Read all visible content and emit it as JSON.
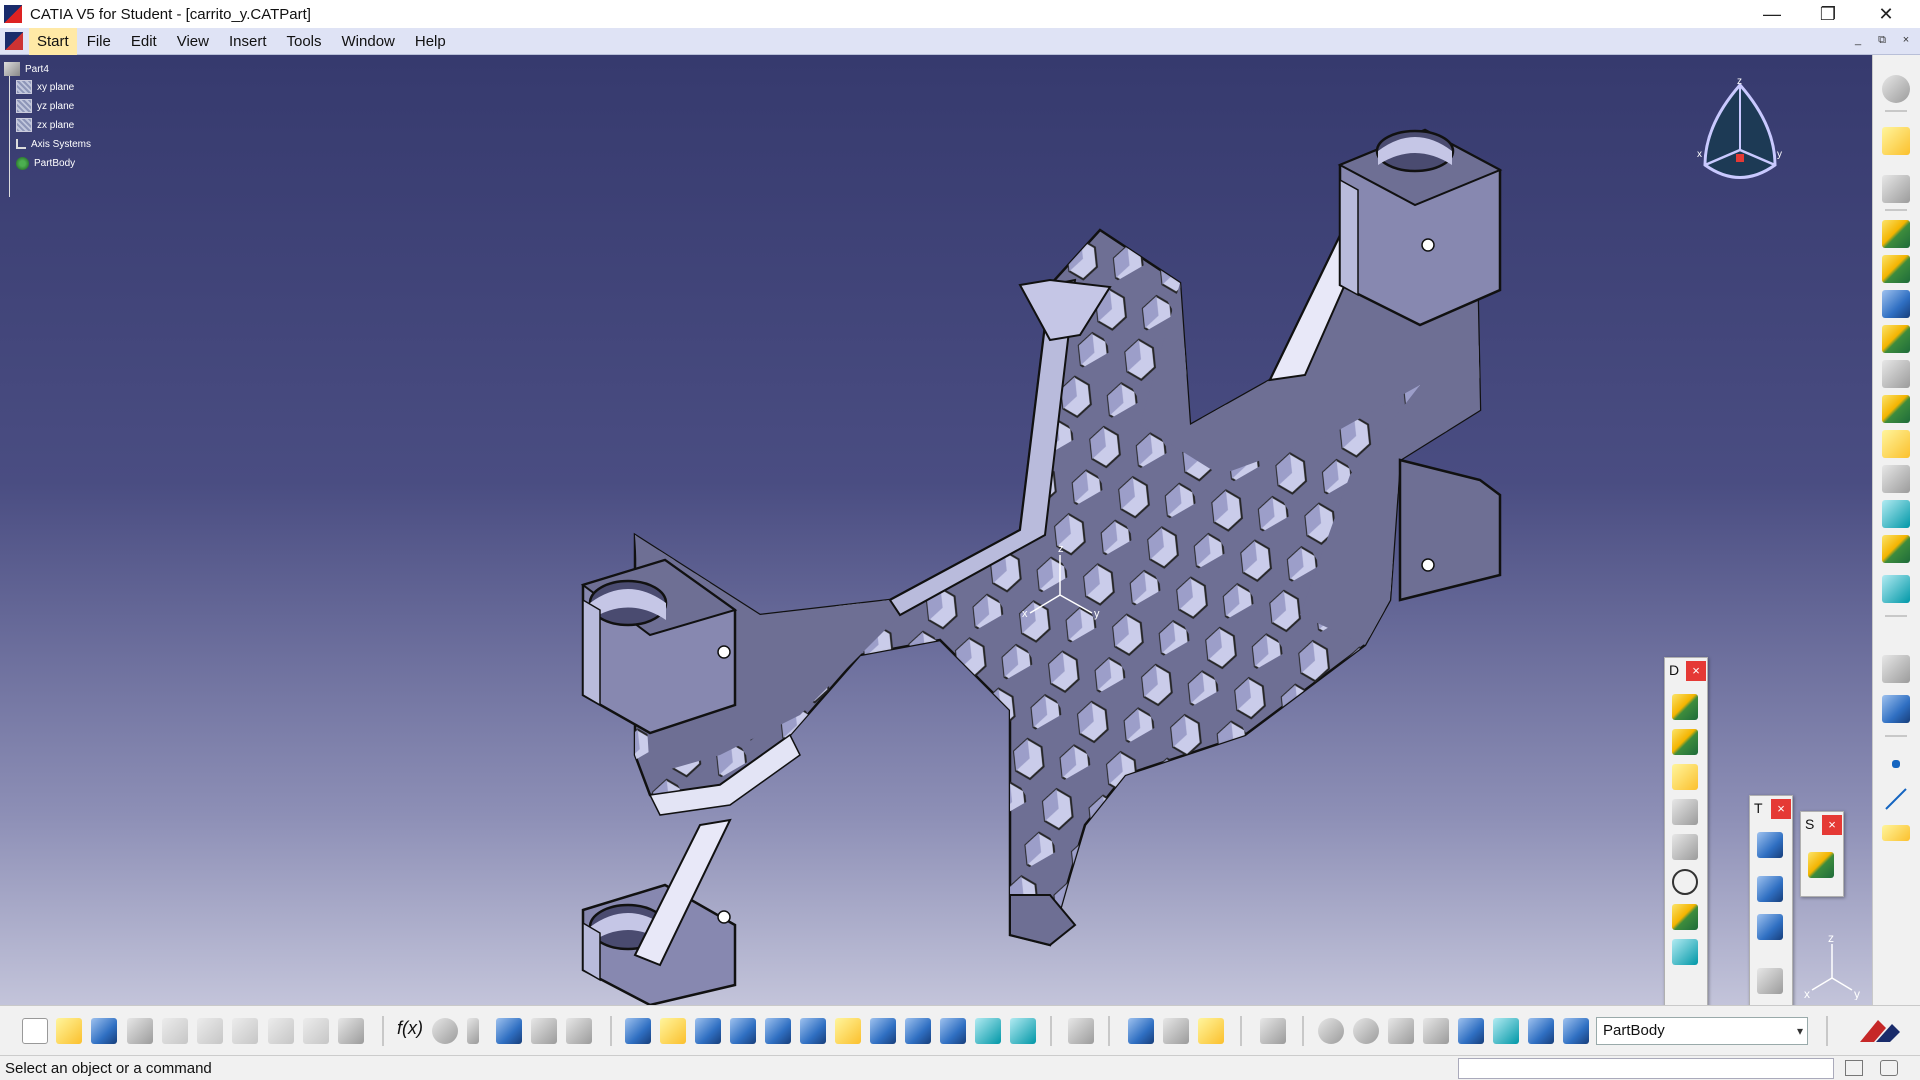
{
  "window": {
    "title": "CATIA V5 for Student - [carrito_y.CATPart]",
    "controls": {
      "minimize": "—",
      "restore": "❐",
      "close": "✕"
    }
  },
  "menubar": {
    "items": [
      "Start",
      "File",
      "Edit",
      "View",
      "Insert",
      "Tools",
      "Window",
      "Help"
    ],
    "mdi_controls": {
      "minimize": "_",
      "restore": "⧉",
      "close": "×"
    }
  },
  "tree": {
    "root": "Part4",
    "items": [
      {
        "label": "xy plane",
        "icon": "plane-icon"
      },
      {
        "label": "yz plane",
        "icon": "plane-icon"
      },
      {
        "label": "zx plane",
        "icon": "plane-icon"
      },
      {
        "label": "Axis Systems",
        "icon": "axis-systems-icon"
      },
      {
        "label": "PartBody",
        "icon": "partbody-icon"
      }
    ]
  },
  "compass": {
    "axes": [
      "z",
      "x",
      "y"
    ]
  },
  "axis_triad": {
    "labels": [
      "z",
      "x",
      "y"
    ]
  },
  "floating_toolbars": [
    {
      "title": "D",
      "close": "×"
    },
    {
      "title": "T",
      "close": "×"
    },
    {
      "title": "S",
      "close": "×"
    }
  ],
  "bottom_toolbar": {
    "formula_label": "f(x)",
    "current_body": "PartBody"
  },
  "statusbar": {
    "text": "Select an object or a command"
  },
  "colors": {
    "viewport_top": "#363a6e",
    "viewport_bottom": "#c3c4da",
    "part_face": "#6e6f94",
    "part_light_face": "#b9bbdc",
    "menu_bg": "#dfe3f5",
    "start_highlight": "#ffe9a6"
  }
}
